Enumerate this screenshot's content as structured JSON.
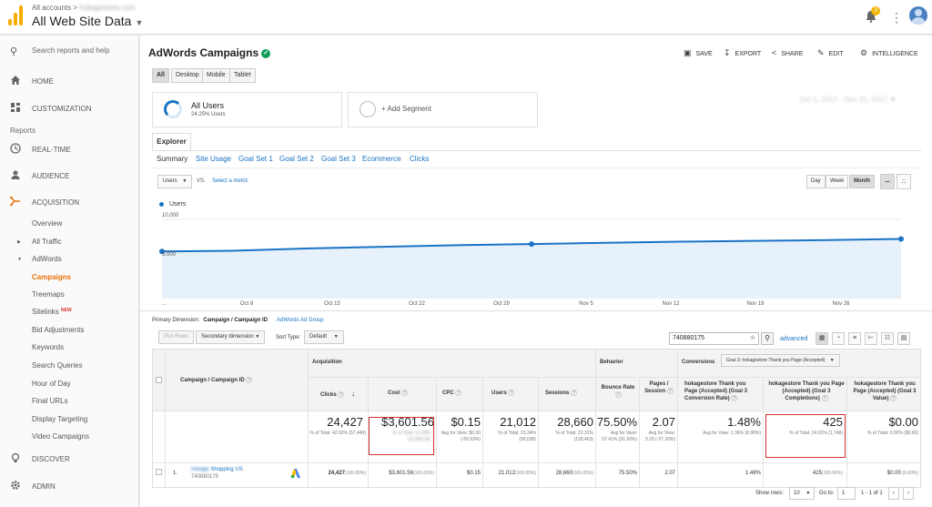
{
  "topbar": {
    "crumb_root": "All accounts",
    "crumb_sep": ">",
    "crumb_account": "hokagestore.com",
    "account_title": "All Web Site Data",
    "notification_count": "3"
  },
  "sidebar": {
    "search_placeholder": "Search reports and help",
    "home": "Home",
    "customization": "Customization",
    "reports_section": "Reports",
    "realtime": "Real-Time",
    "audience": "Audience",
    "acquisition": "Acquisition",
    "overview": "Overview",
    "all_traffic": "All Traffic",
    "adwords": "AdWords",
    "campaigns": "Campaigns",
    "treemaps": "Treemaps",
    "sitelinks": "Sitelinks",
    "sitelinks_badge": "NEW",
    "bid_adjustments": "Bid Adjustments",
    "keywords": "Keywords",
    "search_queries": "Search Queries",
    "hour_of_day": "Hour of Day",
    "final_urls": "Final URLs",
    "display_targeting": "Display Targeting",
    "video_campaigns": "Video Campaigns",
    "discover": "Discover",
    "admin": "Admin"
  },
  "header": {
    "title": "AdWords Campaigns",
    "save": "SAVE",
    "export": "EXPORT",
    "share": "SHARE",
    "edit": "EDIT",
    "intelligence": "INTELLIGENCE"
  },
  "devices": [
    "All",
    "Desktop",
    "Mobile",
    "Tablet"
  ],
  "segments": {
    "all_users_label": "All Users",
    "all_users_pct": "24.25% Users",
    "add_segment": "+ Add Segment"
  },
  "date_range": "Oct 1, 2017 - Dec 31, 2017",
  "explorer_tab": "Explorer",
  "subtabs": [
    "Summary",
    "Site Usage",
    "Goal Set 1",
    "Goal Set 2",
    "Goal Set 3",
    "Ecommerce",
    "Clicks"
  ],
  "chart_controls": {
    "metric": "Users",
    "vs": "VS.",
    "select_metric": "Select a metric",
    "day": "Day",
    "week": "Week",
    "month": "Month"
  },
  "chart_data": {
    "type": "line",
    "series": [
      {
        "name": "Users",
        "values": [
          5900,
          6000,
          6300,
          6500,
          6700,
          6850,
          7000,
          7150,
          7250,
          7350,
          7500
        ]
      }
    ],
    "x_ticks": [
      "...",
      "Oct 8",
      "Oct 15",
      "Oct 22",
      "Oct 29",
      "Nov 5",
      "Nov 12",
      "Nov 19",
      "Nov 26"
    ],
    "y_ticks": [
      "10,000",
      "5,000"
    ],
    "ylim": [
      0,
      10000
    ],
    "color": "#1a73c4"
  },
  "table_controls": {
    "primary_dimension_label": "Primary Dimension:",
    "primary_dimension": "Campaign / Campaign ID",
    "alt_dimension": "AdWords Ad Group",
    "plot_rows": "Plot Rows",
    "secondary_dimension": "Secondary dimension",
    "sort_type_label": "Sort Type:",
    "sort_type": "Default",
    "search_value": "740880175",
    "advanced": "advanced",
    "conversions_label": "Conversions",
    "goal_select": "Goal 3: hokagestore Thank you Page (Accepted)"
  },
  "table": {
    "group_acquisition": "Acquisition",
    "group_behavior": "Behavior",
    "col_campaign": "Campaign / Campaign ID",
    "col_clicks": "Clicks",
    "col_cost": "Cost",
    "col_cpc": "CPC",
    "col_users": "Users",
    "col_sessions": "Sessions",
    "col_bounce": "Bounce Rate",
    "col_pages": "Pages / Session",
    "col_conv_rate": "hokagestore Thank you Page (Accepted) (Goal 3 Conversion Rate)",
    "col_completions": "hokagestore Thank you Page (Accepted) (Goal 3 Completions)",
    "col_value": "hokagestore Thank you Page (Accepted) (Goal 3 Value)",
    "totals": {
      "clicks": "24,427",
      "clicks_sub": "% of Total: 42.52% (57,449)",
      "cost": "$3,601.56",
      "cost_sub": "% of Total: 31.09% (11,584.26)",
      "cpc": "$0.15",
      "cpc_sub": "Avg for View: $0.30 (-50.63%)",
      "users": "21,012",
      "users_sub": "% of Total: 23.34% (90,038)",
      "sessions": "28,660",
      "sessions_sub": "% of Total: 22.31% (128,463)",
      "bounce": "75.50%",
      "bounce_sub": "Avg for View: 57.41% (31.50%)",
      "pages": "2.07",
      "pages_sub": "Avg for View: 3.29 (-37.20%)",
      "conv_rate": "1.48%",
      "conv_rate_sub": "Avg for View: 1.36% (8.98%)",
      "completions": "425",
      "completions_sub": "% of Total: 24.31% (1,748)",
      "value": "$0.00",
      "value_sub": "% of Total: 0.00% ($0.00)"
    },
    "rows": [
      {
        "index": "1.",
        "name_prefix": "hokage",
        "name": "Shopping US",
        "id": "740880175",
        "clicks": "24,427",
        "clicks_pct": "(100.00%)",
        "cost": "$3,601.56",
        "cost_pct": "(100.00%)",
        "cpc": "$0.15",
        "users": "21,012",
        "users_pct": "(100.00%)",
        "sessions": "28,660",
        "sessions_pct": "(100.00%)",
        "bounce": "75.50%",
        "pages": "2.07",
        "conv_rate": "1.48%",
        "completions": "425",
        "completions_pct": "(100.00%)",
        "value": "$0.00",
        "value_pct": "(0.00%)"
      }
    ]
  },
  "pagination": {
    "show_rows_label": "Show rows:",
    "show_rows": "10",
    "goto_label": "Go to:",
    "goto": "1",
    "range": "1 - 1 of 1"
  }
}
